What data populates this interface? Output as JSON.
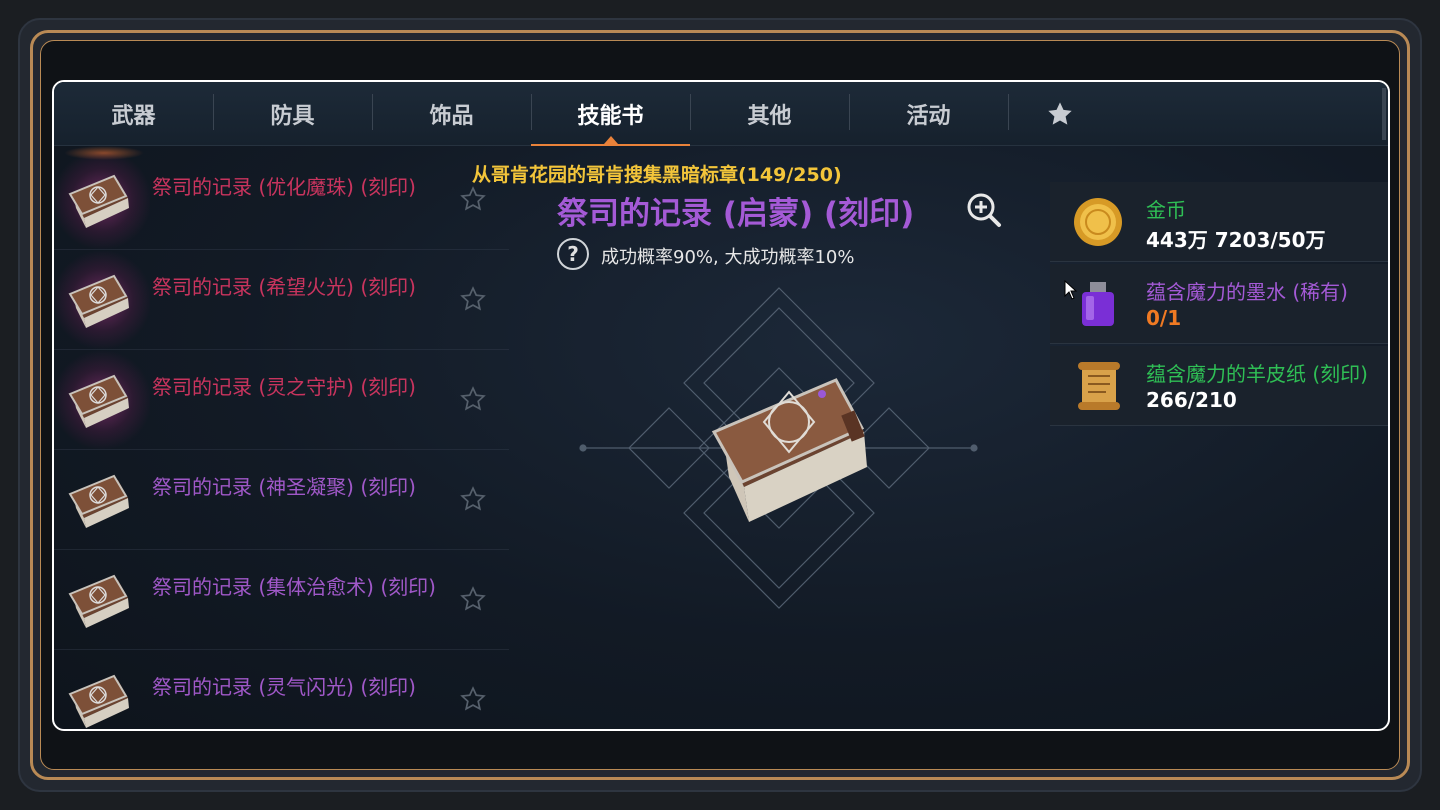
{
  "tabs": [
    {
      "label": "武器"
    },
    {
      "label": "防具"
    },
    {
      "label": "饰品"
    },
    {
      "label": "技能书",
      "active": true
    },
    {
      "label": "其他"
    },
    {
      "label": "活动"
    }
  ],
  "favorite_tab_icon": "star-icon",
  "list": {
    "items": [
      {
        "name": "祭司的记录 (优化魔珠) (刻印)",
        "color": "#c9345e",
        "icon": "book-icon"
      },
      {
        "name": "祭司的记录 (希望火光) (刻印)",
        "color": "#c9345e",
        "icon": "book-icon"
      },
      {
        "name": "祭司的记录 (灵之守护) (刻印)",
        "color": "#c9345e",
        "icon": "book-icon"
      },
      {
        "name": "祭司的记录 (神圣凝聚) (刻印)",
        "color": "#a058c8",
        "icon": "book-icon"
      },
      {
        "name": "祭司的记录 (集体治愈术) (刻印)",
        "color": "#a058c8",
        "icon": "book-icon"
      },
      {
        "name": "祭司的记录 (灵气闪光) (刻印)",
        "color": "#a058c8",
        "icon": "book-icon"
      }
    ]
  },
  "detail": {
    "quest": "从哥肯花园的哥肯搜集黑暗标章(149/250)",
    "title": "祭司的记录 (启蒙) (刻印)",
    "help_symbol": "?",
    "rate": "成功概率90%, 大成功概率10%"
  },
  "materials": [
    {
      "name": "金币",
      "count": "443万 7203/50万",
      "icon": "gold-coin-icon"
    },
    {
      "name": "蕴含魔力的墨水 (稀有)",
      "count": "0/1",
      "icon": "ink-bottle-icon"
    },
    {
      "name": "蕴含魔力的羊皮纸 (刻印)",
      "count": "266/210",
      "icon": "scroll-icon"
    }
  ],
  "colors": {
    "accent": "#e9823a",
    "quest": "#f3c53a",
    "epic": "#a45ad6",
    "legendary_red": "#c9345e",
    "material_green": "#2fbf55",
    "insufficient": "#f07a23"
  }
}
